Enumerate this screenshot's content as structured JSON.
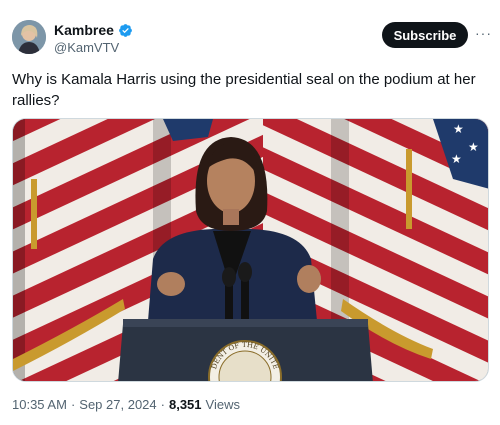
{
  "author": {
    "display_name": "Kambree",
    "handle": "@KamVTV",
    "verified_icon": "verified-badge-icon"
  },
  "actions": {
    "subscribe_label": "Subscribe",
    "more_label": "···"
  },
  "tweet": {
    "text": "Why is Kamala Harris using the presidential seal on the podium at her rallies?"
  },
  "media": {
    "seal_text": "DENT OF THE UNITE"
  },
  "meta": {
    "time": "10:35 AM",
    "date": "Sep 27, 2024",
    "views_count": "8,351",
    "views_label": "Views",
    "separator": "·"
  },
  "colors": {
    "subscribe_bg": "#0f1419",
    "verified": "#1d9bf0",
    "secondary_text": "#536471"
  }
}
